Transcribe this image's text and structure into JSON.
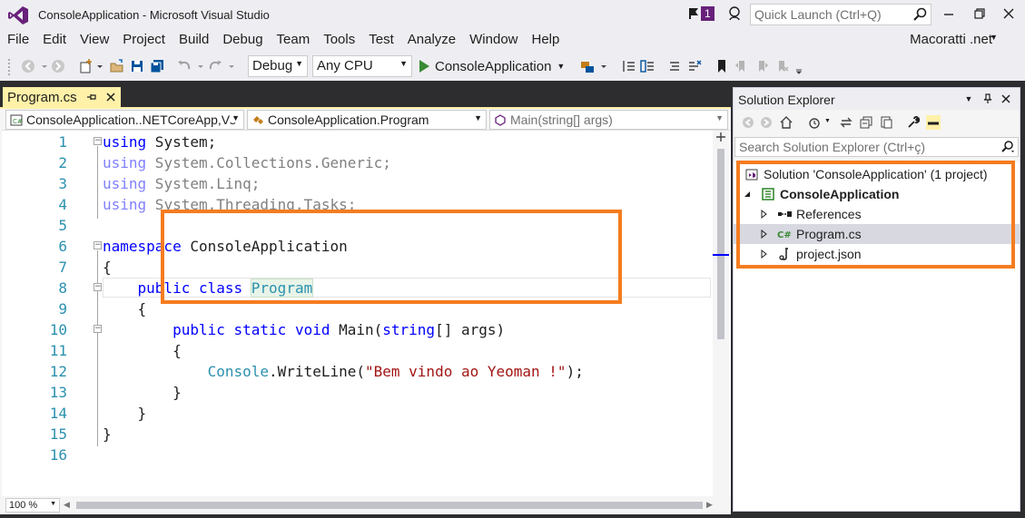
{
  "window": {
    "title": "ConsoleApplication - Microsoft Visual Studio",
    "notification_count": "1",
    "quick_launch_placeholder": "Quick Launch (Ctrl+Q)"
  },
  "menu": {
    "items": [
      "File",
      "Edit",
      "View",
      "Project",
      "Build",
      "Debug",
      "Team",
      "Tools",
      "Test",
      "Analyze",
      "Window",
      "Help"
    ],
    "user": "Macoratti .net"
  },
  "toolbar": {
    "configuration": "Debug",
    "platform": "Any CPU",
    "start_label": "ConsoleApplication"
  },
  "editor": {
    "tab_label": "Program.cs",
    "nav_project": "ConsoleApplication..NETCoreApp,Ve",
    "nav_class": "ConsoleApplication.Program",
    "nav_member": "Main(string[] args)",
    "zoom": "100 %",
    "lines": [
      {
        "n": "1",
        "tokens": [
          {
            "t": "using",
            "c": "kw"
          },
          {
            "t": " System;",
            "c": ""
          }
        ]
      },
      {
        "n": "2",
        "tokens": [
          {
            "t": "using",
            "c": "dimkw"
          },
          {
            "t": " System.Collections.Generic;",
            "c": "dim"
          }
        ]
      },
      {
        "n": "3",
        "tokens": [
          {
            "t": "using",
            "c": "dimkw"
          },
          {
            "t": " System.Linq;",
            "c": "dim"
          }
        ]
      },
      {
        "n": "4",
        "tokens": [
          {
            "t": "using",
            "c": "dimkw"
          },
          {
            "t": " System.Threading.Tasks;",
            "c": "dim"
          }
        ]
      },
      {
        "n": "5",
        "tokens": []
      },
      {
        "n": "6",
        "tokens": [
          {
            "t": "namespace",
            "c": "kw"
          },
          {
            "t": " ConsoleApplication",
            "c": ""
          }
        ]
      },
      {
        "n": "7",
        "tokens": [
          {
            "t": "{",
            "c": ""
          }
        ]
      },
      {
        "n": "8",
        "tokens": [
          {
            "t": "    ",
            "c": ""
          },
          {
            "t": "public",
            "c": "kw"
          },
          {
            "t": " ",
            "c": ""
          },
          {
            "t": "class",
            "c": "kw"
          },
          {
            "t": " ",
            "c": ""
          },
          {
            "t": "Program",
            "c": "ty hl"
          }
        ]
      },
      {
        "n": "9",
        "tokens": [
          {
            "t": "    {",
            "c": ""
          }
        ]
      },
      {
        "n": "10",
        "tokens": [
          {
            "t": "        ",
            "c": ""
          },
          {
            "t": "public",
            "c": "kw"
          },
          {
            "t": " ",
            "c": ""
          },
          {
            "t": "static",
            "c": "kw"
          },
          {
            "t": " ",
            "c": ""
          },
          {
            "t": "void",
            "c": "kw"
          },
          {
            "t": " Main(",
            "c": ""
          },
          {
            "t": "string",
            "c": "kw"
          },
          {
            "t": "[] args)",
            "c": ""
          }
        ]
      },
      {
        "n": "11",
        "tokens": [
          {
            "t": "        {",
            "c": ""
          }
        ]
      },
      {
        "n": "12",
        "tokens": [
          {
            "t": "            ",
            "c": ""
          },
          {
            "t": "Console",
            "c": "ty"
          },
          {
            "t": ".WriteLine(",
            "c": ""
          },
          {
            "t": "\"Bem vindo ao Yeoman !\"",
            "c": "str"
          },
          {
            "t": ");",
            "c": ""
          }
        ]
      },
      {
        "n": "13",
        "tokens": [
          {
            "t": "        }",
            "c": ""
          }
        ]
      },
      {
        "n": "14",
        "tokens": [
          {
            "t": "    }",
            "c": ""
          }
        ]
      },
      {
        "n": "15",
        "tokens": [
          {
            "t": "}",
            "c": ""
          }
        ]
      },
      {
        "n": "16",
        "tokens": []
      }
    ]
  },
  "solution_explorer": {
    "title": "Solution Explorer",
    "search_placeholder": "Search Solution Explorer (Ctrl+ç)",
    "nodes": [
      {
        "label": "Solution 'ConsoleApplication' (1 project)",
        "icon": "solution-icon",
        "bold": false
      },
      {
        "label": "ConsoleApplication",
        "icon": "project-icon",
        "bold": true
      },
      {
        "label": "References",
        "icon": "references-icon",
        "bold": false
      },
      {
        "label": "Program.cs",
        "icon": "csharp-file-icon",
        "bold": false,
        "selected": true
      },
      {
        "label": "project.json",
        "icon": "json-file-icon",
        "bold": false
      }
    ]
  },
  "colors": {
    "vs_purple": "#68217a",
    "annotation_orange": "#f57c20",
    "tab_active": "#fff1a8"
  }
}
